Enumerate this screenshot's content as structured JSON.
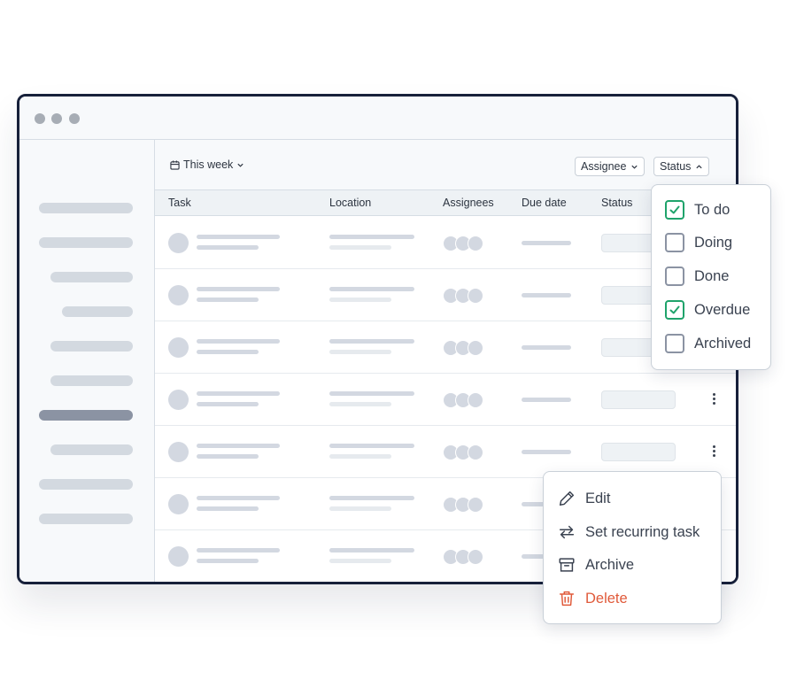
{
  "toolbar": {
    "date_filter": "This week",
    "assignee_filter": "Assignee",
    "status_filter": "Status"
  },
  "table": {
    "columns": [
      "Task",
      "Location",
      "Assignees",
      "Due date",
      "Status"
    ]
  },
  "status_dropdown": {
    "options": [
      {
        "label": "To do",
        "checked": true
      },
      {
        "label": "Doing",
        "checked": false
      },
      {
        "label": "Done",
        "checked": false
      },
      {
        "label": "Overdue",
        "checked": true
      },
      {
        "label": "Archived",
        "checked": false
      }
    ]
  },
  "row_menu": {
    "items": [
      {
        "label": "Edit",
        "icon": "pencil-icon"
      },
      {
        "label": "Set recurring task",
        "icon": "repeat-icon"
      },
      {
        "label": "Archive",
        "icon": "archive-box-icon"
      },
      {
        "label": "Delete",
        "icon": "trash-icon"
      }
    ]
  },
  "colors": {
    "window_border": "#17203a",
    "check_accent": "#1fa36b",
    "danger": "#e05a3a",
    "skeleton": "#d3d8e1"
  }
}
